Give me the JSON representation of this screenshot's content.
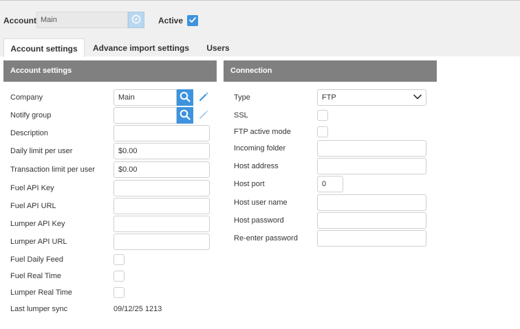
{
  "header": {
    "account_label": "Account",
    "account_value": "Main",
    "active_label": "Active",
    "active_checked": true
  },
  "tabs": [
    {
      "label": "Account settings",
      "active": true
    },
    {
      "label": "Advance import settings",
      "active": false
    },
    {
      "label": "Users",
      "active": false
    }
  ],
  "account_settings": {
    "title": "Account settings",
    "company_label": "Company",
    "company_value": "Main",
    "notify_group_label": "Notify group",
    "notify_group_value": "",
    "description_label": "Description",
    "description_value": "",
    "daily_limit_label": "Daily limit per user",
    "daily_limit_value": "$0.00",
    "transaction_limit_label": "Transaction limit per user",
    "transaction_limit_value": "$0.00",
    "fuel_api_key_label": "Fuel API Key",
    "fuel_api_key_value": "",
    "fuel_api_url_label": "Fuel API URL",
    "fuel_api_url_value": "",
    "lumper_api_key_label": "Lumper API Key",
    "lumper_api_key_value": "",
    "lumper_api_url_label": "Lumper API URL",
    "lumper_api_url_value": "",
    "fuel_daily_feed_label": "Fuel Daily Feed",
    "fuel_real_time_label": "Fuel Real Time",
    "lumper_real_time_label": "Lumper Real Time",
    "last_lumper_sync_label": "Last lumper sync",
    "last_lumper_sync_value": "09/12/25 1213"
  },
  "connection": {
    "title": "Connection",
    "type_label": "Type",
    "type_value": "FTP",
    "ssl_label": "SSL",
    "ftp_active_mode_label": "FTP active mode",
    "incoming_folder_label": "Incoming folder",
    "incoming_folder_value": "",
    "host_address_label": "Host address",
    "host_address_value": "",
    "host_port_label": "Host port",
    "host_port_value": "0",
    "host_user_name_label": "Host user name",
    "host_user_name_value": "",
    "host_password_label": "Host password",
    "host_password_value": "",
    "reenter_password_label": "Re-enter password",
    "reenter_password_value": ""
  },
  "colors": {
    "accent": "#3d93dd",
    "panel_header": "#808080",
    "topbar": "#f0f0f0"
  },
  "icons": {
    "account_lookup": "compass-icon",
    "search": "search-icon",
    "edit": "pencil-icon",
    "dropdown": "chevron-down-icon",
    "check": "check-icon"
  }
}
